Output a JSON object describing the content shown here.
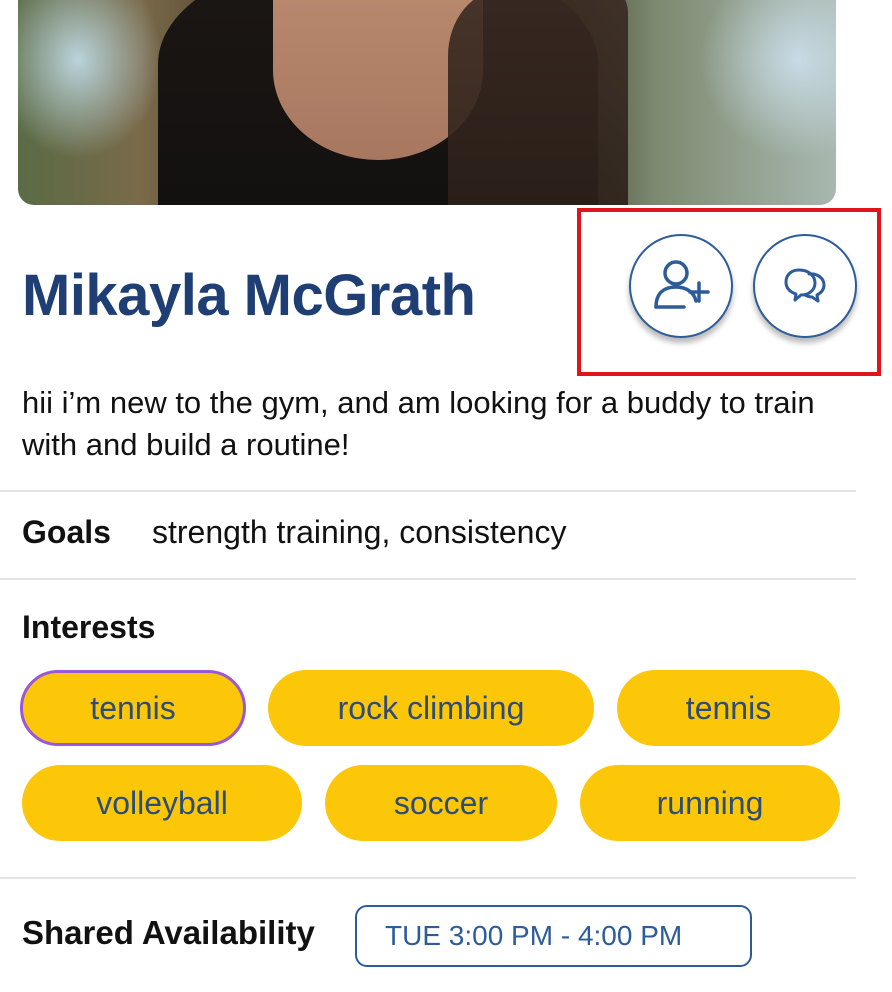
{
  "profile": {
    "name": "Mikayla McGrath",
    "bio": "hii i’m new to the gym, and am looking for a buddy to train with and build a routine!"
  },
  "actions": {
    "add_friend_icon": "user-plus-icon",
    "message_icon": "chat-bubbles-icon",
    "button_color": "#2d5c9a"
  },
  "goals": {
    "label": "Goals",
    "value": "strength training, consistency"
  },
  "interests": {
    "label": "Interests",
    "chip_color": "#fcc609",
    "selected_border_color": "#9a58d8",
    "items": [
      {
        "label": "tennis",
        "selected": true
      },
      {
        "label": "rock climbing",
        "selected": false
      },
      {
        "label": "tennis",
        "selected": false
      },
      {
        "label": "volleyball",
        "selected": false
      },
      {
        "label": "soccer",
        "selected": false
      },
      {
        "label": "running",
        "selected": false
      }
    ]
  },
  "availability": {
    "label": "Shared Availability",
    "slot": "TUE 3:00 PM - 4:00 PM"
  },
  "highlight_color": "#e0151b"
}
